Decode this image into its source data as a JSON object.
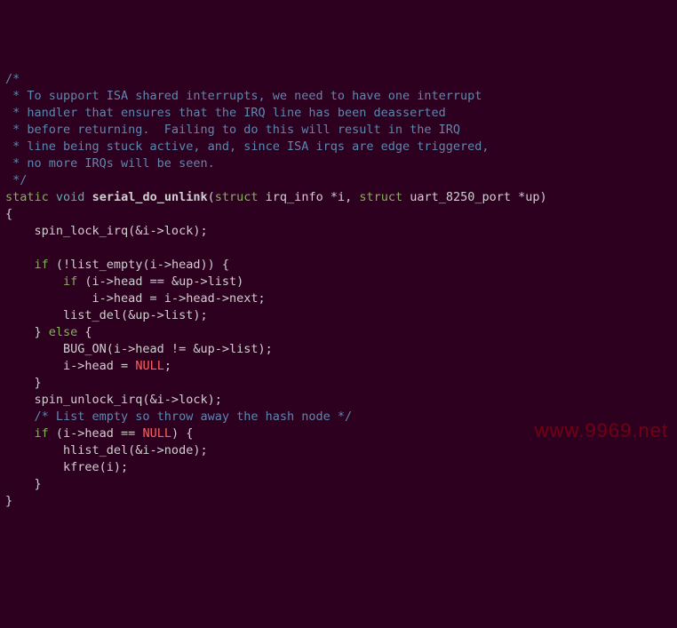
{
  "comment": {
    "l1": "/*",
    "l2": " * To support ISA shared interrupts, we need to have one interrupt",
    "l3": " * handler that ensures that the IRQ line has been deasserted",
    "l4": " * before returning.  Failing to do this will result in the IRQ",
    "l5": " * line being stuck active, and, since ISA irqs are edge triggered,",
    "l6": " * no more IRQs will be seen.",
    "l7": " */"
  },
  "decl": {
    "static": "static",
    "void": "void",
    "sp": " ",
    "fn": "serial_do_unlink",
    "op": "(",
    "struct1": "struct",
    "args1": " irq_info *i, ",
    "struct2": "struct",
    "args2": " uart_8250_port *up)"
  },
  "body": {
    "ob": "{",
    "l1": "    spin_lock_irq(&i->lock);",
    "blank1": "",
    "if1_a": "    ",
    "if1_kw": "if",
    "if1_b": " (!list_empty(i->head)) {",
    "if2_a": "        ",
    "if2_kw": "if",
    "if2_b": " (i->head == &up->list)",
    "l4": "            i->head = i->head->next;",
    "l5": "        list_del(&up->list);",
    "else_a": "    } ",
    "else_kw": "else",
    "else_b": " {",
    "l7": "        BUG_ON(i->head != &up->list);",
    "null1_a": "        i->head = ",
    "null1_kw": "NULL",
    "null1_b": ";",
    "l9": "    }",
    "l10": "    spin_unlock_irq(&i->lock);",
    "cmt2": "    /* List empty so throw away the hash node */",
    "if3_a": "    ",
    "if3_kw": "if",
    "if3_b": " (i->head == ",
    "null2_kw": "NULL",
    "if3_c": ") {",
    "l13": "        hlist_del(&i->node);",
    "l14": "        kfree(i);",
    "l15": "    }",
    "cb": "}"
  },
  "watermark": "www.9969.net"
}
